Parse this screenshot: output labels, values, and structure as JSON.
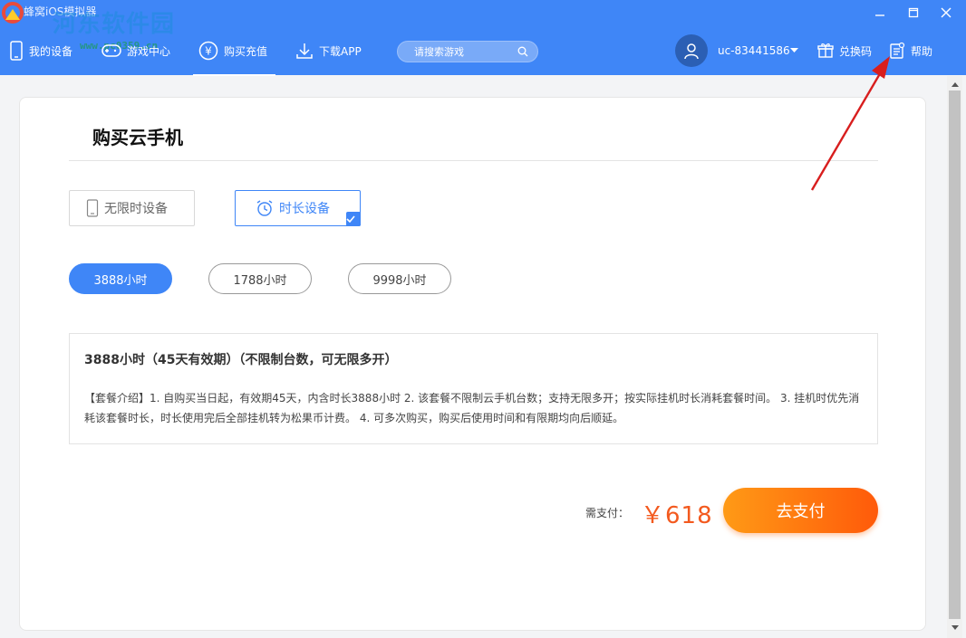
{
  "window": {
    "app_title": "蜂窝iOS模拟器",
    "watermark": "河东软件园",
    "watermark_url": "www.pc0359.cn"
  },
  "nav": {
    "items": [
      {
        "label": "我的设备",
        "icon": "phone-icon"
      },
      {
        "label": "游戏中心",
        "icon": "gamepad-icon"
      },
      {
        "label": "购买充值",
        "icon": "yen-circle-icon",
        "active": true
      },
      {
        "label": "下载APP",
        "icon": "download-icon"
      }
    ]
  },
  "search": {
    "placeholder": "请搜索游戏"
  },
  "user": {
    "name": "uc-83441586"
  },
  "header_buttons": {
    "redeem": "兑换码",
    "help": "帮助"
  },
  "page": {
    "title": "购买云手机"
  },
  "device_tabs": [
    {
      "label": "无限时设备",
      "icon": "phone-outline-icon",
      "active": false
    },
    {
      "label": "时长设备",
      "icon": "alarm-clock-icon",
      "active": true
    }
  ],
  "packages": [
    {
      "label": "3888小时",
      "active": true
    },
    {
      "label": "1788小时",
      "active": false
    },
    {
      "label": "9998小时",
      "active": false
    }
  ],
  "description": {
    "title": "3888小时（45天有效期）（不限制台数，可无限多开）",
    "text": "【套餐介绍】1. 自购买当日起，有效期45天，内含时长3888小时 2. 该套餐不限制云手机台数；支持无限多开；按实际挂机时长消耗套餐时间。 3. 挂机时优先消耗该套餐时长，时长使用完后全部挂机转为松果币计费。 4. 可多次购买，购买后使用时间和有限期均向后顺延。"
  },
  "payment": {
    "label": "需支付：",
    "amount": "￥618",
    "button": "去支付"
  },
  "colors": {
    "header": "#3f86f7",
    "accent": "#3f86f7",
    "price": "#f35a1f",
    "pay_button_start": "#ff9a16",
    "pay_button_end": "#ff5a0a",
    "annotation_arrow": "#d81e1e"
  }
}
